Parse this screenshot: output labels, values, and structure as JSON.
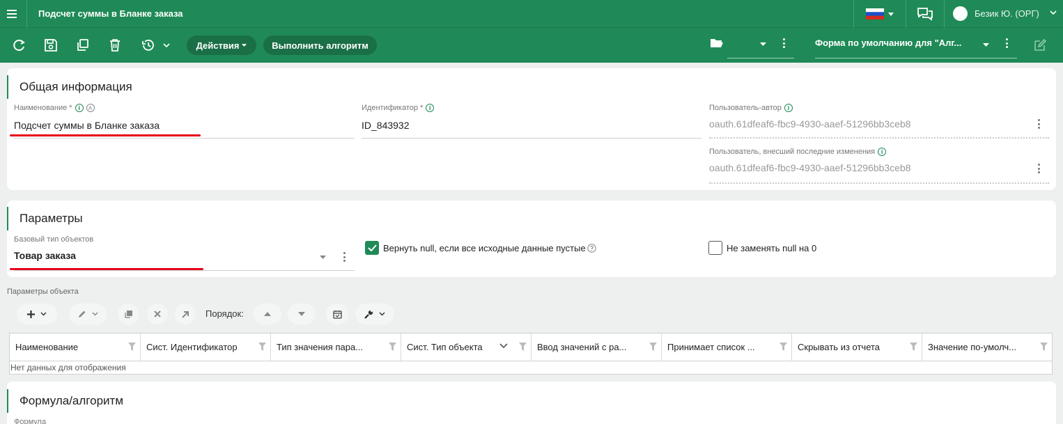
{
  "header": {
    "title": "Подсчет суммы в Бланке заказа",
    "user": "Безик Ю. (ОРГ)"
  },
  "toolbar": {
    "actions_label": "Действия",
    "run_label": "Выполнить алгоритм",
    "form_select": "Форма по умолчанию для \"Алг..."
  },
  "general": {
    "title": "Общая информация",
    "name_label": "Наименование *",
    "name_value": "Подсчет суммы в Бланке заказа",
    "id_label": "Идентификатор *",
    "id_value": "ID_843932",
    "author_label": "Пользователь-автор",
    "author_value": "oauth.61dfeaf6-fbc9-4930-aaef-51296bb3ceb8",
    "modifier_label": "Пользователь, внесший последние изменения",
    "modifier_value": "oauth.61dfeaf6-fbc9-4930-aaef-51296bb3ceb8",
    "a_badge": "A"
  },
  "params": {
    "title": "Параметры",
    "base_type_label": "Базовый тип объектов",
    "base_type_value": "Товар заказа",
    "return_null_label": "Вернуть null, если все исходные данные пустые",
    "return_null_checked": true,
    "no_replace_label": "Не заменять null на 0",
    "no_replace_checked": false
  },
  "object_params": {
    "label": "Параметры объекта",
    "order_label": "Порядок:",
    "columns": [
      "Наименование",
      "Сист. Идентификатор",
      "Тип значения пара...",
      "Сист. Тип объекта",
      "Ввод значений с ра...",
      "Принимает список ...",
      "Скрывать из отчета",
      "Значение по-умолч..."
    ],
    "empty_text": "Нет данных для отображения"
  },
  "formula": {
    "title": "Формула/алгоритм",
    "label": "Формула"
  },
  "colors": {
    "brand": "#1f8a57",
    "brand_dark": "#1a6f46",
    "highlight": "#e8001c"
  }
}
